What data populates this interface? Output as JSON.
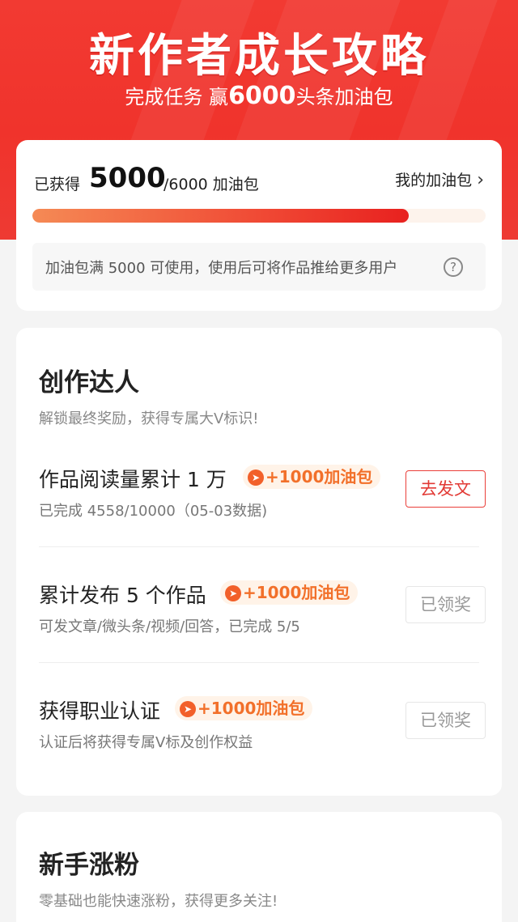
{
  "hero": {
    "title": "新作者成长攻略",
    "subtitle_prefix": "完成任务  赢",
    "subtitle_amount": "6000",
    "subtitle_suffix": "头条加油包"
  },
  "progress": {
    "got_label": "已获得",
    "got_value": "5000",
    "total_text": "/6000 加油包",
    "my_pack_label": "我的加油包",
    "fill_fraction": 0.83,
    "tip": "加油包满 5000 可使用，使用后可将作品推给更多用户",
    "help_glyph": "?"
  },
  "creator_section": {
    "title": "创作达人",
    "desc": "解锁最终奖励，获得专属大V标识!",
    "tasks": [
      {
        "title": "作品阅读量累计 1 万",
        "reward": "+1000加油包",
        "sub": "已完成 4558/10000（05-03数据)",
        "button": "去发文"
      },
      {
        "title": "累计发布 5 个作品",
        "reward": "+1000加油包",
        "sub": "可发文章/微头条/视频/回答，已完成 5/5",
        "button": "已领奖"
      },
      {
        "title": "获得职业认证",
        "reward": "+1000加油包",
        "sub": "认证后将获得专属V标及创作权益",
        "button": "已领奖"
      }
    ]
  },
  "fans_section": {
    "title": "新手涨粉",
    "desc": "零基础也能快速涨粉，获得更多关注!"
  },
  "icons": {
    "chevron": "chevron-right-icon",
    "help": "question-circle-icon",
    "reward": "fuel-badge-icon"
  },
  "colors": {
    "brand_red": "#f0332c",
    "reward_orange": "#f2702a",
    "button_red": "#e23a35"
  }
}
